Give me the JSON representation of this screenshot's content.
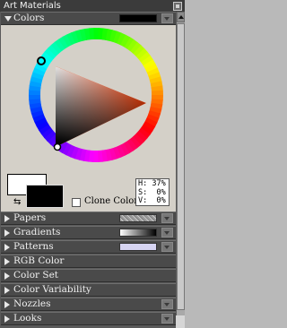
{
  "window": {
    "title": "Art Materials"
  },
  "colors": {
    "label": "Colors",
    "hsv": {
      "h": "H: 37%",
      "s": "S:  0%",
      "v": "V:  0%"
    },
    "clone_color_label": "Clone Color",
    "primary_color": "#ffffff",
    "secondary_color": "#000000",
    "header_swatch": "#000000",
    "triangle_hue": "#ff3b00"
  },
  "sections": [
    {
      "label": "Papers",
      "swatch": "paper-texture",
      "menu": true
    },
    {
      "label": "Gradients",
      "swatch": "gradient-preview",
      "menu": true
    },
    {
      "label": "Patterns",
      "swatch": "pattern-preview",
      "menu": true
    },
    {
      "label": "RGB Color",
      "swatch": "",
      "menu": false
    },
    {
      "label": "Color Set",
      "swatch": "",
      "menu": false
    },
    {
      "label": "Color Variability",
      "swatch": "",
      "menu": false
    },
    {
      "label": "Nozzles",
      "swatch": "",
      "menu": true
    },
    {
      "label": "Looks",
      "swatch": "",
      "menu": true
    }
  ],
  "icons": {
    "close": "close-icon",
    "expand": "triangle-right-icon",
    "collapse": "triangle-down-icon",
    "menu": "palette-menu-icon",
    "swap": "swap-colors-icon"
  }
}
